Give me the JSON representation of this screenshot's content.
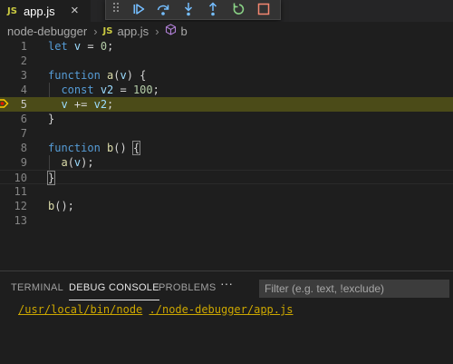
{
  "tab": {
    "label": "app.js",
    "badge": "JS",
    "close": "×"
  },
  "debug_toolbar": {
    "buttons": [
      "continue-icon",
      "step-over-icon",
      "step-into-icon",
      "step-out-icon",
      "restart-icon",
      "stop-icon"
    ],
    "colors": {
      "continue": "#75beff",
      "restart": "#89d185",
      "stop": "#f48771"
    }
  },
  "breadcrumb": {
    "folder": "node-debugger",
    "file_badge": "JS",
    "file": "app.js",
    "symbol": "b"
  },
  "editor": {
    "line_numbers": [
      "1",
      "2",
      "3",
      "4",
      "5",
      "6",
      "7",
      "8",
      "9",
      "10",
      "11",
      "12",
      "13"
    ],
    "current_line": 5
  },
  "panel": {
    "tabs": [
      "TERMINAL",
      "DEBUG CONSOLE",
      "PROBLEMS"
    ],
    "active_tab": "DEBUG CONSOLE",
    "more": "···",
    "filter_placeholder": "Filter (e.g. text, !exclude)",
    "output": {
      "path1": "/usr/local/bin/node",
      "path2": "./node-debugger/app.js"
    }
  }
}
